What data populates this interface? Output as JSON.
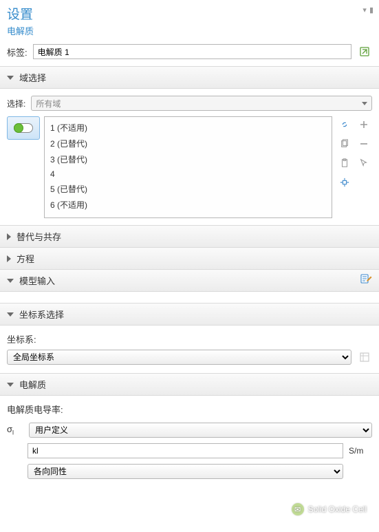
{
  "header": {
    "title": "设置",
    "subtitle": "电解质"
  },
  "label_row": {
    "label": "标签:",
    "value": "电解质 1"
  },
  "sections": {
    "domain_sel": {
      "title": "域选择",
      "select_label": "选择:",
      "select_value": "所有域",
      "items": [
        "1 (不适用)",
        "2 (已替代)",
        "3 (已替代)",
        "4",
        "5 (已替代)",
        "6 (不适用)"
      ]
    },
    "override": {
      "title": "替代与共存"
    },
    "equation": {
      "title": "方程"
    },
    "model_input": {
      "title": "模型输入"
    },
    "coord": {
      "title": "坐标系选择",
      "label": "坐标系:",
      "value": "全局坐标系"
    },
    "electrolyte": {
      "title": "电解质",
      "cond_label": "电解质电导率:",
      "sigma_symbol": "σ",
      "sigma_sub": "l",
      "type_value": "用户定义",
      "expr_value": "kl",
      "expr_unit": "S/m",
      "iso_value": "各向同性"
    }
  },
  "icons": {
    "open_ext": "open-external-icon",
    "link": "link-icon",
    "copy": "copy-icon",
    "plus": "plus-icon",
    "minus": "minus-icon",
    "paste": "paste-icon",
    "cursor": "cursor-icon",
    "target": "target-icon",
    "edit_note": "edit-note-icon"
  },
  "watermark": "Solid Oxide Cell"
}
